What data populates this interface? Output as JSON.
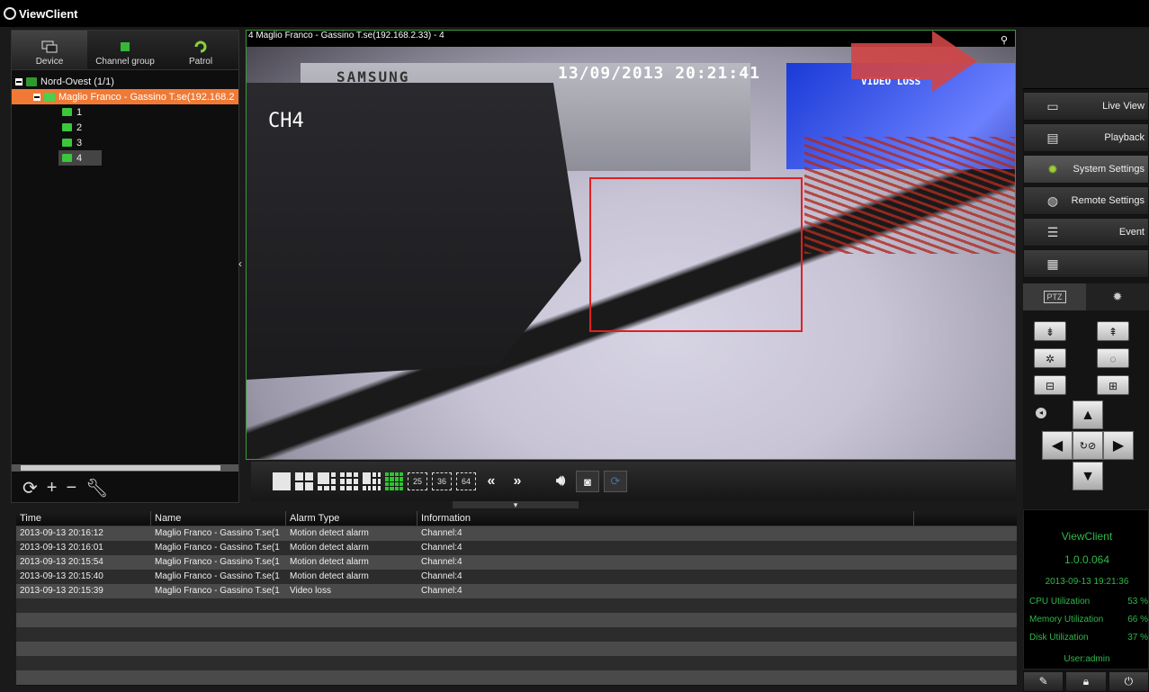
{
  "app": {
    "title": "ViewClient"
  },
  "left_panel": {
    "tabs": [
      {
        "label": "Device"
      },
      {
        "label": "Channel group"
      },
      {
        "label": "Patrol"
      }
    ],
    "tree": {
      "group": "Nord-Ovest (1/1)",
      "device": "Maglio Franco - Gassino T.se(192.168.2",
      "channels": [
        "1",
        "2",
        "3",
        "4"
      ]
    }
  },
  "video": {
    "title": "4 Maglio Franco - Gassino T.se(192.168.2.33) - 4",
    "osd_datetime": "13/09/2013 20:21:41",
    "osd_channel": "CH4",
    "monitor_brand": "SAMSUNG",
    "video_loss_text": "VIDEO LOSS"
  },
  "toolbar": {
    "num_layouts": [
      "25",
      "36",
      "64"
    ],
    "prev": "«",
    "next": "»"
  },
  "right_panel": {
    "menu": [
      {
        "label": "Live View",
        "icon": "monitor-icon"
      },
      {
        "label": "Playback",
        "icon": "playback-icon"
      },
      {
        "label": "System Settings",
        "icon": "gear-icon"
      },
      {
        "label": "Remote Settings",
        "icon": "globe-icon"
      },
      {
        "label": "Event",
        "icon": "list-icon"
      },
      {
        "label": "",
        "icon": "grid-icon"
      }
    ],
    "ptz_tab": "PTZ"
  },
  "info": {
    "app_name": "ViewClient",
    "version": "1.0.0.064",
    "datetime": "2013-09-13 19:21:36",
    "cpu_label": "CPU Utilization",
    "cpu_value": "53 %",
    "mem_label": "Memory Utilization",
    "mem_value": "66 %",
    "disk_label": "Disk Utilization",
    "disk_value": "37 %",
    "user": "User:admin"
  },
  "alarm_table": {
    "columns": [
      "Time",
      "Name",
      "Alarm Type",
      "Information",
      ""
    ],
    "rows": [
      [
        "2013-09-13 20:16:12",
        "Maglio Franco - Gassino T.se(1",
        "Motion detect alarm",
        "Channel:4"
      ],
      [
        "2013-09-13 20:16:01",
        "Maglio Franco - Gassino T.se(1",
        "Motion detect alarm",
        "Channel:4"
      ],
      [
        "2013-09-13 20:15:54",
        "Maglio Franco - Gassino T.se(1",
        "Motion detect alarm",
        "Channel:4"
      ],
      [
        "2013-09-13 20:15:40",
        "Maglio Franco - Gassino T.se(1",
        "Motion detect alarm",
        "Channel:4"
      ],
      [
        "2013-09-13 20:15:39",
        "Maglio Franco - Gassino T.se(1",
        "Video loss",
        "Channel:4"
      ],
      [
        "",
        "",
        "",
        ""
      ],
      [
        "",
        "",
        "",
        ""
      ],
      [
        "",
        "",
        "",
        ""
      ],
      [
        "",
        "",
        "",
        ""
      ],
      [
        "",
        "",
        "",
        ""
      ],
      [
        "",
        "",
        "",
        ""
      ]
    ]
  }
}
